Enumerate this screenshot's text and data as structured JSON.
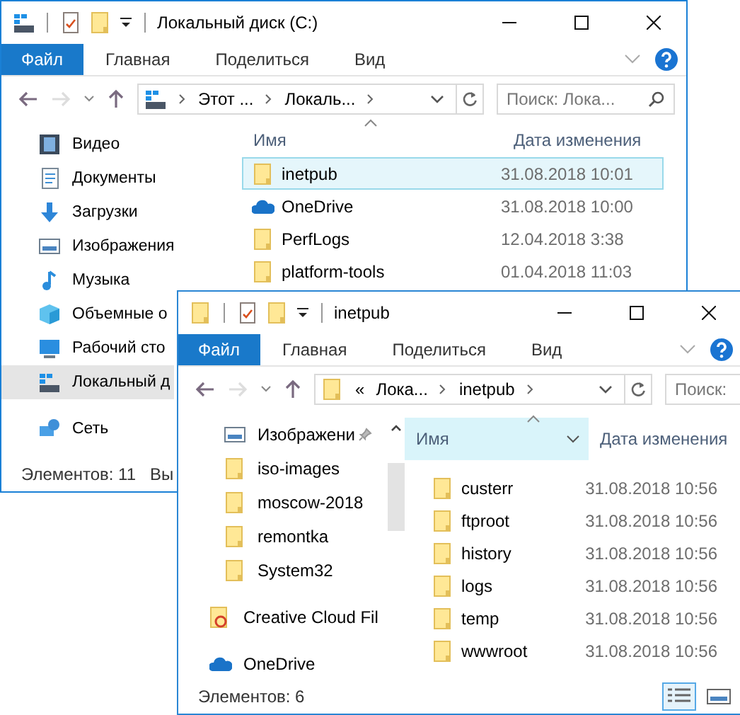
{
  "windows": [
    {
      "title": "Локальный диск (C:)",
      "tabs": [
        {
          "label": "Файл",
          "selected": true
        },
        {
          "label": "Главная",
          "selected": false
        },
        {
          "label": "Поделиться",
          "selected": false
        },
        {
          "label": "Вид",
          "selected": false
        }
      ],
      "address": {
        "crumbs": [
          "Этот ...",
          "Локаль..."
        ]
      },
      "search": {
        "placeholder": "Поиск: Лока..."
      },
      "nav_groups": [
        {
          "items": [
            {
              "label": "Видео",
              "kind": "video",
              "selected": false
            },
            {
              "label": "Документы",
              "kind": "docs",
              "selected": false
            },
            {
              "label": "Загрузки",
              "kind": "download",
              "selected": false
            },
            {
              "label": "Изображения",
              "kind": "pictures",
              "selected": false
            },
            {
              "label": "Музыка",
              "kind": "music",
              "selected": false
            },
            {
              "label": "Объемные о",
              "kind": "cube",
              "selected": false
            },
            {
              "label": "Рабочий сто",
              "kind": "desktop",
              "selected": false
            },
            {
              "label": "Локальный д",
              "kind": "drive",
              "selected": true
            }
          ]
        },
        {
          "items": [
            {
              "label": "Сеть",
              "kind": "network",
              "selected": false
            }
          ]
        }
      ],
      "columns": [
        {
          "label": "Имя",
          "hovered": false
        },
        {
          "label": "Дата изменения",
          "hovered": false
        }
      ],
      "files": [
        {
          "name": "inetpub",
          "date": "31.08.2018 10:01",
          "kind": "folder",
          "selected": true
        },
        {
          "name": "OneDrive",
          "date": "31.08.2018 10:00",
          "kind": "onedrive",
          "selected": false
        },
        {
          "name": "PerfLogs",
          "date": "12.04.2018 3:38",
          "kind": "folder",
          "selected": false
        },
        {
          "name": "platform-tools",
          "date": "01.04.2018 11:03",
          "kind": "folder",
          "selected": false
        }
      ],
      "status": [
        "Элементов: 11",
        "Вы"
      ]
    },
    {
      "title": "inetpub",
      "tabs": [
        {
          "label": "Файл",
          "selected": true
        },
        {
          "label": "Главная",
          "selected": false
        },
        {
          "label": "Поделиться",
          "selected": false
        },
        {
          "label": "Вид",
          "selected": false
        }
      ],
      "address": {
        "overflow": "«",
        "crumbs": [
          "Лока...",
          "inetpub"
        ]
      },
      "search": {
        "placeholder": "Поиск:"
      },
      "nav_groups": [
        {
          "items": [
            {
              "label": "Изображени",
              "kind": "pictures",
              "selected": false,
              "pinned": true
            },
            {
              "label": "iso-images",
              "kind": "folder",
              "selected": false,
              "pinned": false
            },
            {
              "label": "moscow-2018",
              "kind": "folder",
              "selected": false,
              "pinned": false
            },
            {
              "label": "remontka",
              "kind": "folder",
              "selected": false,
              "pinned": false
            },
            {
              "label": "System32",
              "kind": "folder",
              "selected": false,
              "pinned": false
            }
          ]
        },
        {
          "items": [
            {
              "label": "Creative Cloud Fil",
              "kind": "creative",
              "selected": false,
              "pinned": false
            }
          ]
        },
        {
          "items": [
            {
              "label": "OneDrive",
              "kind": "onedrive",
              "selected": false,
              "pinned": false
            }
          ]
        }
      ],
      "columns": [
        {
          "label": "Имя",
          "hovered": true
        },
        {
          "label": "Дата изменения",
          "hovered": false
        }
      ],
      "files": [
        {
          "name": "custerr",
          "date": "31.08.2018 10:56",
          "kind": "folder",
          "selected": false
        },
        {
          "name": "ftproot",
          "date": "31.08.2018 10:56",
          "kind": "folder",
          "selected": false
        },
        {
          "name": "history",
          "date": "31.08.2018 10:56",
          "kind": "folder",
          "selected": false
        },
        {
          "name": "logs",
          "date": "31.08.2018 10:56",
          "kind": "folder",
          "selected": false
        },
        {
          "name": "temp",
          "date": "31.08.2018 10:56",
          "kind": "folder",
          "selected": false
        },
        {
          "name": "wwwroot",
          "date": "31.08.2018 10:56",
          "kind": "folder",
          "selected": false
        }
      ],
      "status": [
        "Элементов: 6"
      ],
      "views": [
        {
          "kind": "details",
          "selected": true
        },
        {
          "kind": "tiles",
          "selected": false
        }
      ]
    }
  ]
}
